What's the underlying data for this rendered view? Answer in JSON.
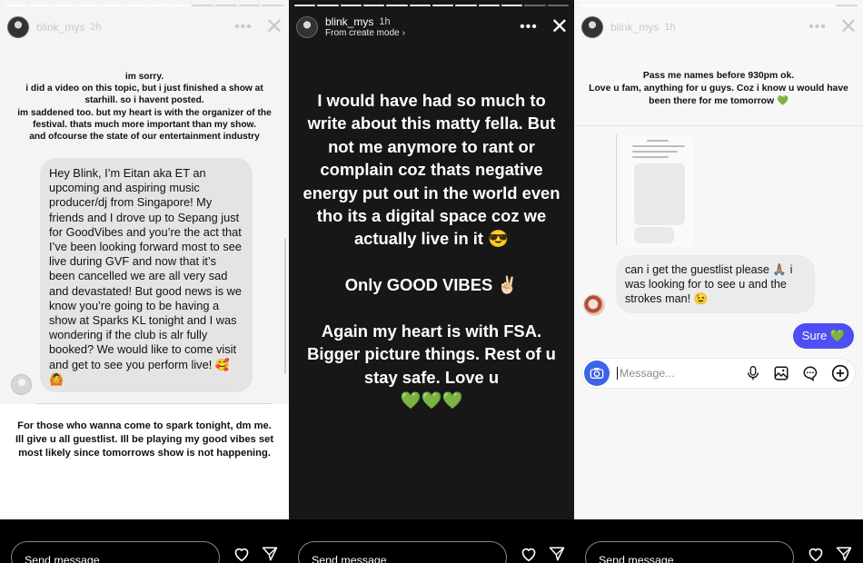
{
  "panels": [
    {
      "username": "blink_mys",
      "time": "2h",
      "top_text": "im sorry.\ni did a video on this topic, but i just finished a show at starhill. so i havent posted.\nim saddened too. but my heart is with the organizer of the festival. thats much more important than my show.\nand ofcourse the state of our entertainment industry",
      "dm_text": "Hey Blink, I’m Eitan aka ET an upcoming and aspiring music producer/dj from Singapore! My friends and I drove up to Sepang just for GoodVibes and you’re the act that I’ve been looking forward most to see live during GVF and now that it’s been cancelled we are all very sad and devastated! But good news is we know you’re going to be having a show at Sparks KL tonight and I was wondering if the club is alr fully booked? We would like to come visit and get to see you perform live! 🥰🙆",
      "bottom_text": "For those who wanna come to spark tonight, dm me. Ill give u all guestlist. Ill be playing my good vibes set most likely since tomorrows show is not happening.",
      "send_placeholder": "Send message"
    },
    {
      "username": "blink_mys",
      "time": "1h",
      "subtitle": "From create mode",
      "body_text": "I would have had so much to write about this matty fella. But not me anymore to rant or complain coz thats negative energy put out in the world even tho its a digital space coz we actually live in it 😎\n\nOnly GOOD VIBES ✌🏻\n\nAgain my heart is with FSA.  Bigger picture things. Rest of u stay safe. Love u\n💚💚💚",
      "send_placeholder": "Send message"
    },
    {
      "username": "blink_mys",
      "time": "1h",
      "top_text": "Pass me names before 930pm ok.\nLove u fam, anything for u guys. Coz i know u would have been there for me tomorrow 💚",
      "dm_text": "can i get the guestlist please 🙏🏽 i was looking for to see u and the strokes man! 😉",
      "reply_text": "Sure 💚",
      "message_placeholder": "Message...",
      "send_placeholder": "Send message"
    }
  ],
  "icons": {
    "more": "more-icon",
    "close": "close-icon",
    "heart": "heart-icon",
    "send": "send-icon",
    "camera": "camera-icon",
    "mic": "mic-icon",
    "gallery": "gallery-icon",
    "sticker": "sticker-icon",
    "add": "add-icon"
  },
  "colors": {
    "accent_blue": "#4e4ef2",
    "camera_blue": "#3d63e8"
  }
}
